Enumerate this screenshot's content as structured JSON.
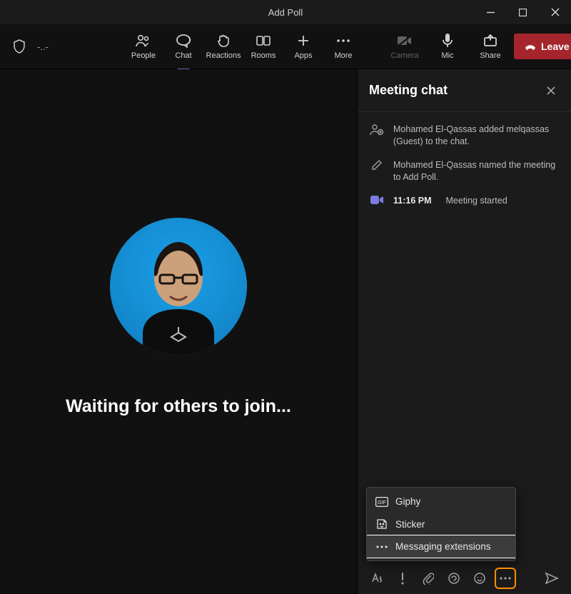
{
  "window": {
    "title": "Add Poll"
  },
  "toolbar": {
    "waveform": "-..-",
    "items": {
      "people": "People",
      "chat": "Chat",
      "reactions": "Reactions",
      "rooms": "Rooms",
      "apps": "Apps",
      "more": "More"
    },
    "controls": {
      "camera": "Camera",
      "mic": "Mic",
      "share": "Share"
    },
    "leave": "Leave"
  },
  "stage": {
    "waiting": "Waiting for others to join..."
  },
  "panel": {
    "title": "Meeting chat",
    "events": [
      "Mohamed El-Qassas added melqassas (Guest) to the chat.",
      "Mohamed El-Qassas named the meeting to Add Poll."
    ],
    "meeting_started": {
      "time": "11:16 PM",
      "text": "Meeting started"
    }
  },
  "popup": {
    "giphy": "Giphy",
    "sticker": "Sticker",
    "extensions": "Messaging extensions"
  }
}
